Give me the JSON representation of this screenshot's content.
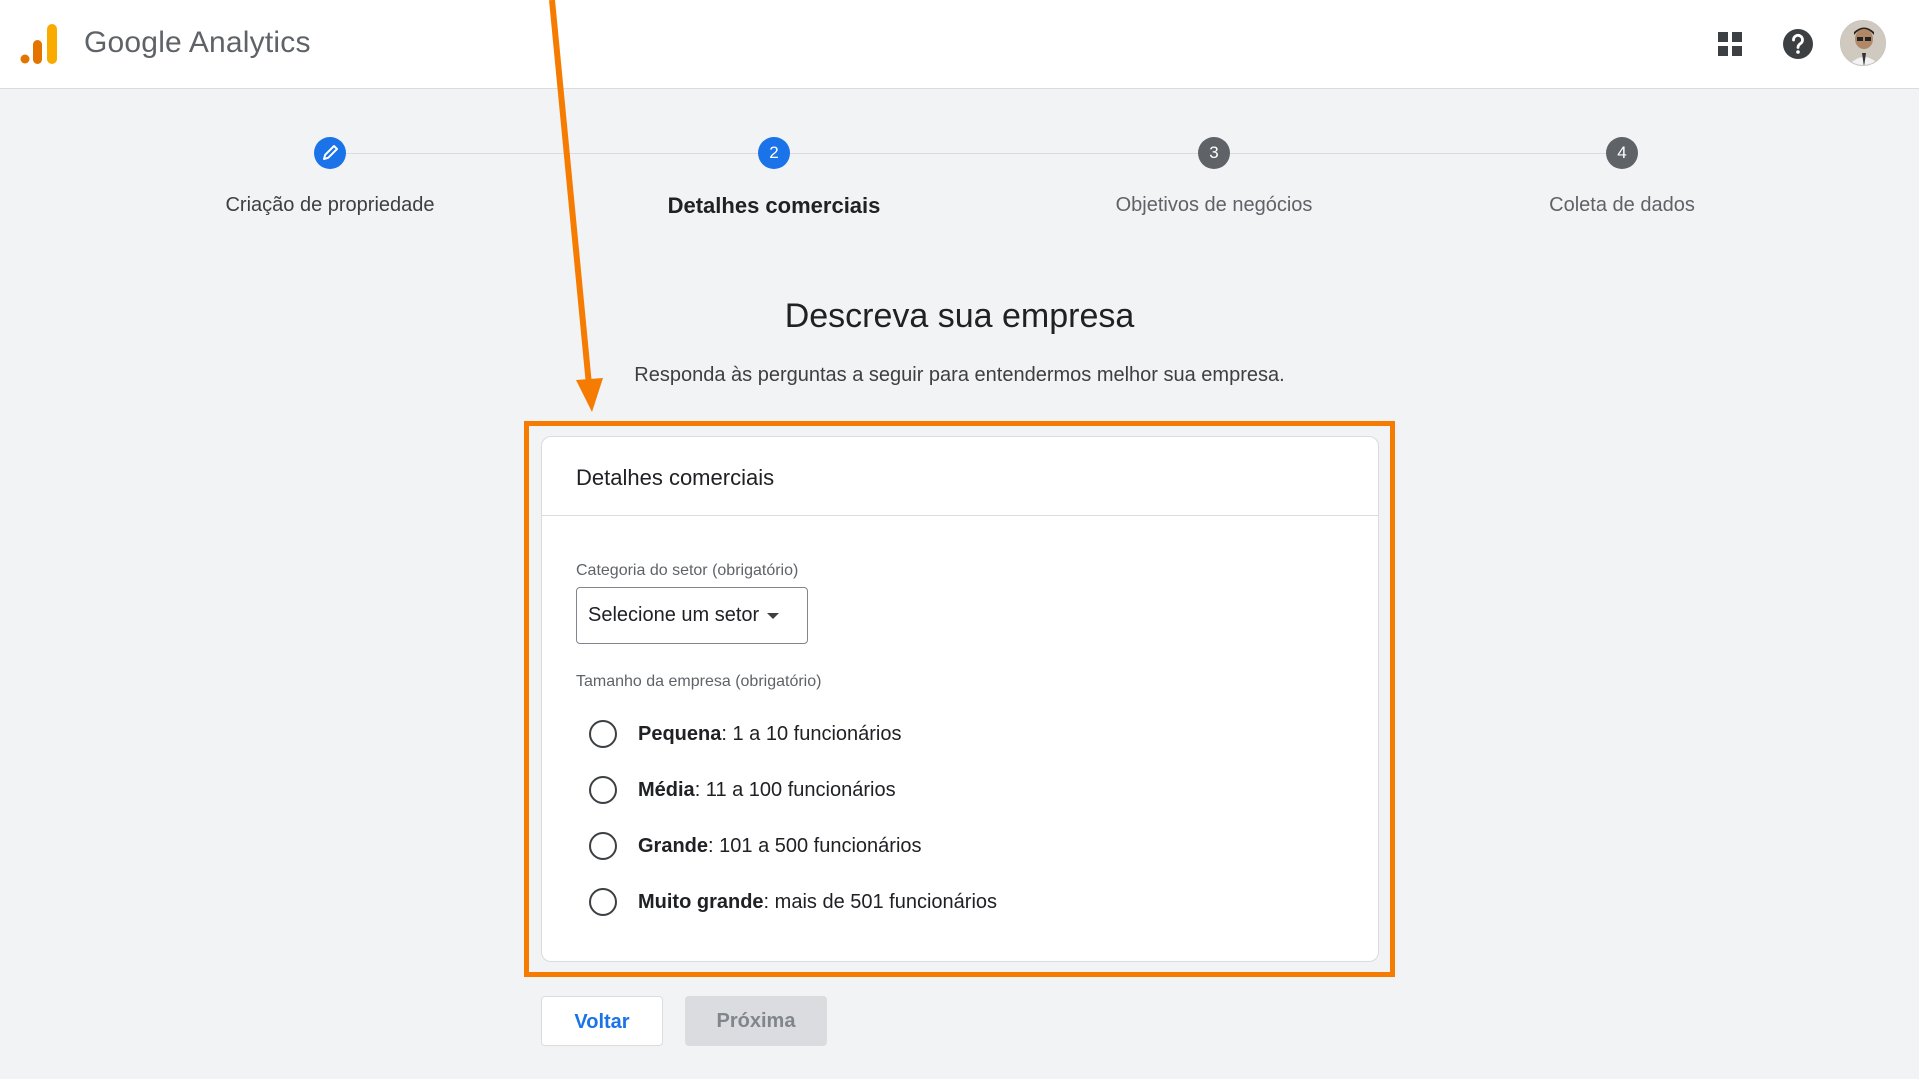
{
  "app": {
    "brand": "Google Analytics",
    "colors": {
      "accent": "#1a73e8",
      "annotation": "#f57c00",
      "logo_orange": "#f9ab00",
      "logo_dark": "#e37400"
    }
  },
  "header_icons": [
    "apps-grid-icon",
    "help-icon",
    "user-avatar"
  ],
  "stepper": {
    "steps": [
      {
        "number": "1",
        "label": "Criação de propriedade",
        "state": "done",
        "icon": "pencil-icon"
      },
      {
        "number": "2",
        "label": "Detalhes comerciais",
        "state": "active"
      },
      {
        "number": "3",
        "label": "Objetivos de negócios",
        "state": "pending"
      },
      {
        "number": "4",
        "label": "Coleta de dados",
        "state": "pending"
      }
    ]
  },
  "page": {
    "title": "Descreva sua empresa",
    "subtitle": "Responda às perguntas a seguir para entendermos melhor sua empresa."
  },
  "card": {
    "title": "Detalhes comerciais",
    "industry": {
      "label": "Categoria do setor (obrigatório)",
      "select_value": "Selecione um setor"
    },
    "size": {
      "label": "Tamanho da empresa (obrigatório)",
      "options": [
        {
          "name": "Pequena",
          "detail": ": 1 a 10 funcionários"
        },
        {
          "name": "Média",
          "detail": ": 11 a 100 funcionários"
        },
        {
          "name": "Grande",
          "detail": ": 101 a 500 funcionários"
        },
        {
          "name": "Muito grande",
          "detail": ": mais de 501 funcionários"
        }
      ]
    }
  },
  "buttons": {
    "back": "Voltar",
    "next": "Próxima"
  }
}
